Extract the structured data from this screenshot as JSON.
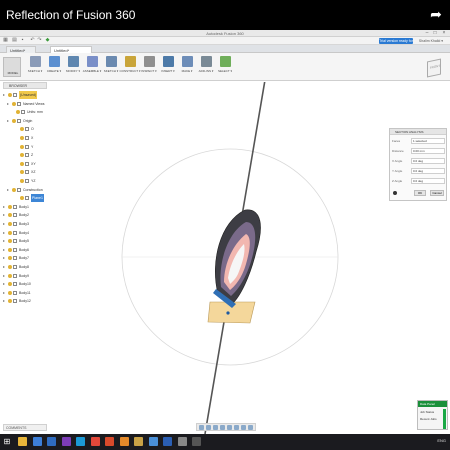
{
  "video": {
    "title": "Reflection of Fusion 360"
  },
  "window": {
    "title": "Autodesk Fusion 360"
  },
  "quick_access": {
    "trial_button": "Trial version ready for 30 days",
    "user_menu": "Shalim Khalid ▾"
  },
  "tabs": [
    {
      "label": "Untitled*"
    }
  ],
  "toolbar": {
    "mode": "MODEL",
    "groups": [
      {
        "label": "SKETCH ▾",
        "color": "#8a9bb8"
      },
      {
        "label": "CREATE ▾",
        "color": "#5b8fd0"
      },
      {
        "label": "MODIFY ▾",
        "color": "#5f87b0"
      },
      {
        "label": "ASSEMBLE ▾",
        "color": "#7a8fc8"
      },
      {
        "label": "SKETCH ▾",
        "color": "#6b8ab0"
      },
      {
        "label": "CONSTRUCT ▾",
        "color": "#c9a53a"
      },
      {
        "label": "INSPECT ▾",
        "color": "#8f8f8f"
      },
      {
        "label": "INSERT ▾",
        "color": "#4d7aa8"
      },
      {
        "label": "MAKE ▾",
        "color": "#6d8db8"
      },
      {
        "label": "ADD-INS ▾",
        "color": "#7a8a96"
      },
      {
        "label": "SELECT ▾",
        "color": "#6fae5a"
      }
    ]
  },
  "viewcube": {
    "label": "FRONT"
  },
  "browser": {
    "header": "BROWSER",
    "items": [
      {
        "label": "(Unsaved)",
        "type": "doc"
      },
      {
        "label": "Named Views",
        "type": "folder"
      },
      {
        "label": "Units: mm",
        "type": "plain"
      },
      {
        "label": "Origin",
        "type": "folder"
      },
      {
        "label": "O",
        "type": "item"
      },
      {
        "label": "X",
        "type": "item"
      },
      {
        "label": "Y",
        "type": "item"
      },
      {
        "label": "Z",
        "type": "item"
      },
      {
        "label": "XY",
        "type": "item"
      },
      {
        "label": "XZ",
        "type": "item"
      },
      {
        "label": "YZ",
        "type": "item"
      },
      {
        "label": "Construction",
        "type": "folder"
      },
      {
        "label": "Plane1",
        "type": "selected"
      },
      {
        "label": "Body1",
        "type": "body"
      },
      {
        "label": "Body2",
        "type": "body"
      },
      {
        "label": "Body3",
        "type": "body"
      },
      {
        "label": "Body4",
        "type": "body"
      },
      {
        "label": "Body5",
        "type": "body"
      },
      {
        "label": "Body6",
        "type": "body"
      },
      {
        "label": "Body7",
        "type": "body"
      },
      {
        "label": "Body8",
        "type": "body"
      },
      {
        "label": "Body9",
        "type": "body"
      },
      {
        "label": "Body10",
        "type": "body"
      },
      {
        "label": "Body11",
        "type": "body"
      },
      {
        "label": "Body12",
        "type": "body"
      }
    ]
  },
  "section_panel": {
    "title": "SECTION ANALYSIS",
    "rows": [
      {
        "label": "Faces",
        "value": "1 selected"
      },
      {
        "label": "Distance",
        "value": "0.00 mm"
      },
      {
        "label": "X Angle",
        "value": "0.0 deg"
      },
      {
        "label": "Y Angle",
        "value": "0.0 deg"
      },
      {
        "label": "Z Angle",
        "value": "0.0 deg"
      }
    ],
    "ok": "OK",
    "cancel": "Cancel"
  },
  "comments": {
    "label": "COMMENTS"
  },
  "data_panel": {
    "title": "Data Panel",
    "rows": [
      "Job Status",
      "Recent Jobs"
    ],
    "accent": "#1a8f3a"
  },
  "taskbar": {
    "start_glyph": "⊞",
    "apps": [
      {
        "name": "file-explorer-icon",
        "color": "#e8b63a"
      },
      {
        "name": "browser-icon",
        "color": "#3d7fd8"
      },
      {
        "name": "store-icon",
        "color": "#2f6cc0"
      },
      {
        "name": "visual-studio-icon",
        "color": "#7d3db8"
      },
      {
        "name": "skype-icon",
        "color": "#1c9ad6"
      },
      {
        "name": "chrome-icon",
        "color": "#e2483a"
      },
      {
        "name": "media-icon",
        "color": "#d94a2b"
      },
      {
        "name": "fusion-icon",
        "color": "#e48a2a"
      },
      {
        "name": "folder-icon",
        "color": "#c9a246"
      },
      {
        "name": "photos-icon",
        "color": "#4a90d8"
      },
      {
        "name": "word-icon",
        "color": "#2b5fb4"
      },
      {
        "name": "settings-icon",
        "color": "#888888"
      },
      {
        "name": "terminal-icon",
        "color": "#555555"
      }
    ],
    "tray_text": "ENG"
  }
}
